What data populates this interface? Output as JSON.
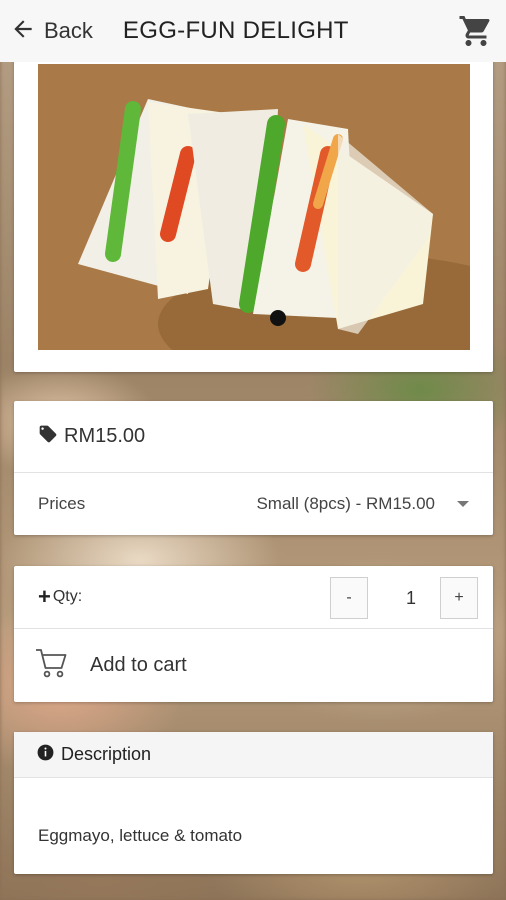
{
  "header": {
    "back_label": "Back",
    "title": "EGG-FUN DELIGHT",
    "back_icon": "arrow-left-icon",
    "cart_icon": "shopping-cart-icon"
  },
  "gallery": {
    "active_slide": 1,
    "slide_count": 1
  },
  "price": {
    "icon": "price-tag-icon",
    "value": "RM15.00"
  },
  "options": {
    "label": "Prices",
    "selected": "Small (8pcs) - RM15.00"
  },
  "quantity": {
    "label": "Qty:",
    "plus_sign": "+",
    "minus_label": "-",
    "plus_label": "+",
    "value": "1"
  },
  "add_to_cart": {
    "label": "Add to cart",
    "icon": "cart-outline-icon"
  },
  "description": {
    "title": "Description",
    "icon": "info-circle-icon",
    "text": "Eggmayo, lettuce & tomato"
  },
  "colors": {
    "header_bg": "#f7f7f7",
    "card_bg": "#ffffff",
    "text": "#333333"
  }
}
